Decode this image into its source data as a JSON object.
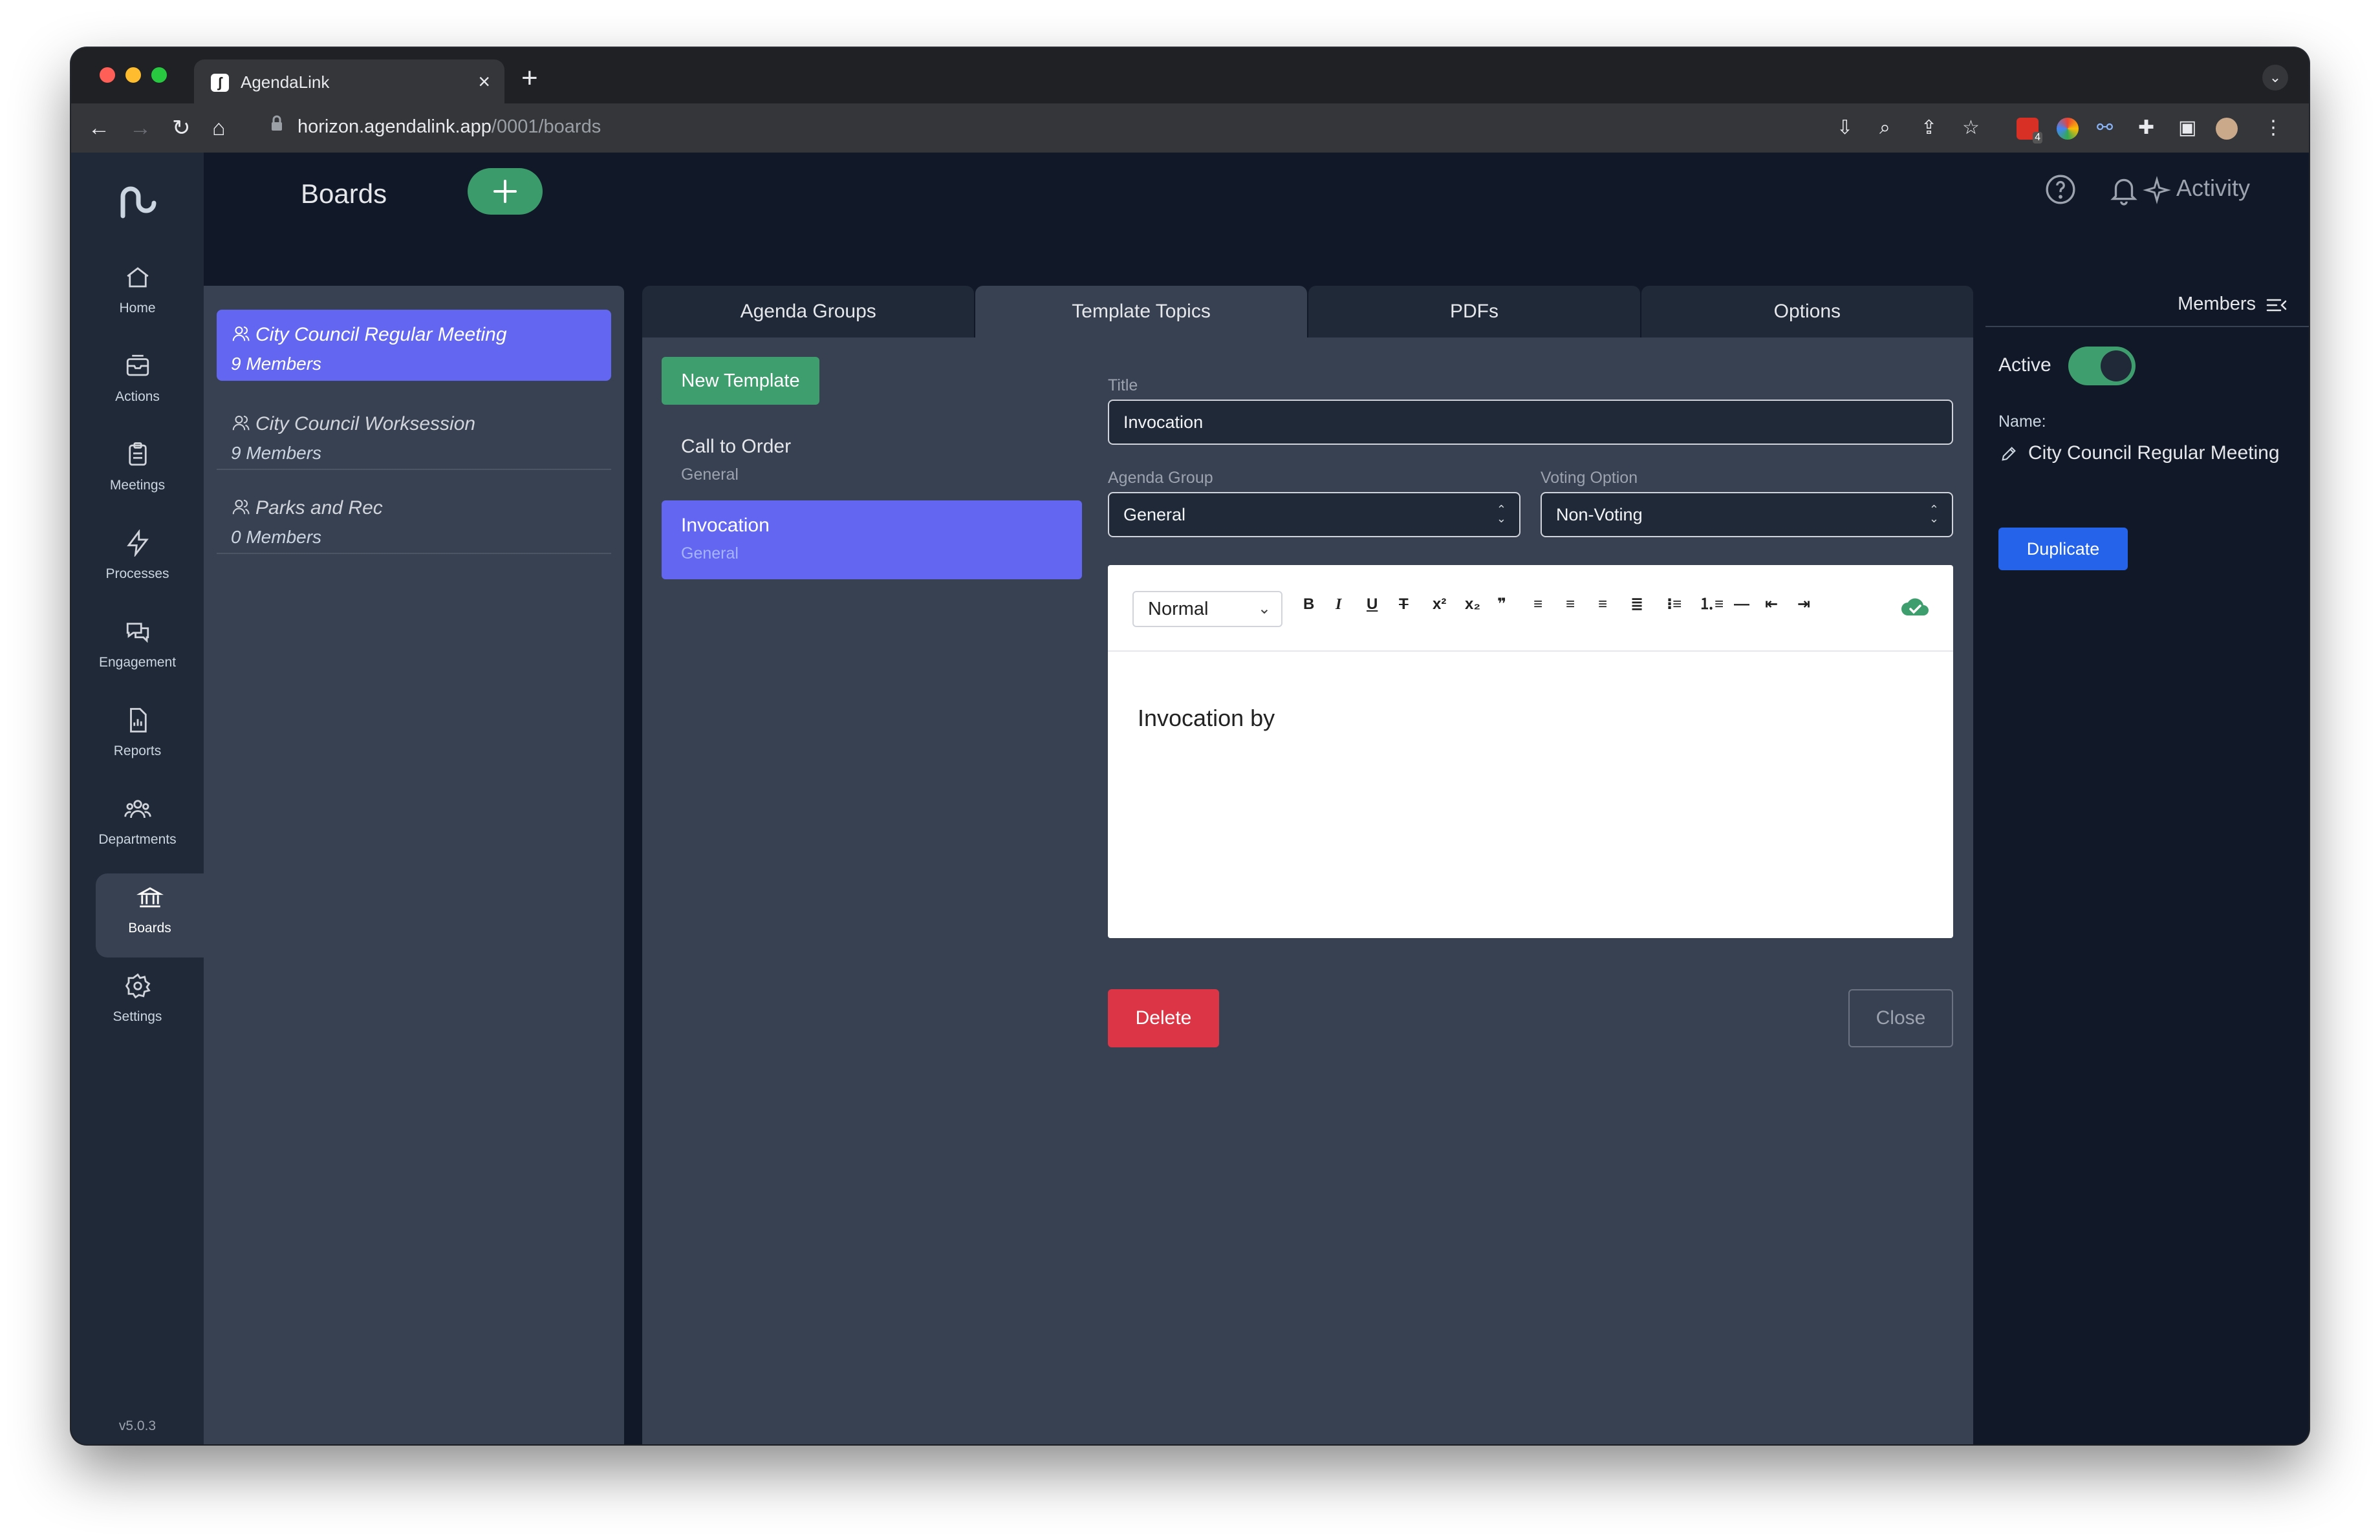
{
  "browser": {
    "tab_title": "AgendaLink",
    "url_host": "horizon.agendalink.app",
    "url_path": "/0001/boards",
    "extension_badge": "4"
  },
  "app": {
    "version": "v5.0.3",
    "nav": [
      {
        "label": "Home",
        "icon": "home-icon"
      },
      {
        "label": "Actions",
        "icon": "inbox-icon"
      },
      {
        "label": "Meetings",
        "icon": "clipboard-icon"
      },
      {
        "label": "Processes",
        "icon": "bolt-icon"
      },
      {
        "label": "Engagement",
        "icon": "chat-icon"
      },
      {
        "label": "Reports",
        "icon": "report-icon"
      },
      {
        "label": "Departments",
        "icon": "users-icon"
      },
      {
        "label": "Boards",
        "icon": "building-icon",
        "active": true
      },
      {
        "label": "Settings",
        "icon": "gear-icon"
      }
    ]
  },
  "header": {
    "title": "Boards",
    "activity_label": "Activity"
  },
  "boards": [
    {
      "name": "City Council Regular Meeting",
      "members": "9 Members",
      "selected": true
    },
    {
      "name": "City Council Worksession",
      "members": "9 Members"
    },
    {
      "name": "Parks and Rec",
      "members": "0 Members"
    }
  ],
  "tabs": [
    "Agenda Groups",
    "Template Topics",
    "PDFs",
    "Options"
  ],
  "active_tab": "Template Topics",
  "topics": {
    "new_button": "New Template",
    "items": [
      {
        "name": "Call to Order",
        "group": "General"
      },
      {
        "name": "Invocation",
        "group": "General",
        "selected": true
      }
    ]
  },
  "form": {
    "title_label": "Title",
    "title_value": "Invocation",
    "agenda_group_label": "Agenda Group",
    "agenda_group_value": "General",
    "voting_label": "Voting Option",
    "voting_value": "Non-Voting",
    "editor_style": "Normal",
    "editor_text": "Invocation by",
    "delete_label": "Delete",
    "close_label": "Close"
  },
  "details": {
    "members_label": "Members",
    "active_label": "Active",
    "active_on": true,
    "name_label": "Name:",
    "name_value": "City Council Regular Meeting",
    "duplicate_label": "Duplicate"
  },
  "colors": {
    "accent_purple": "#6366f1",
    "accent_green": "#3f9e6d",
    "danger": "#dc3545",
    "primary_blue": "#2563eb"
  }
}
